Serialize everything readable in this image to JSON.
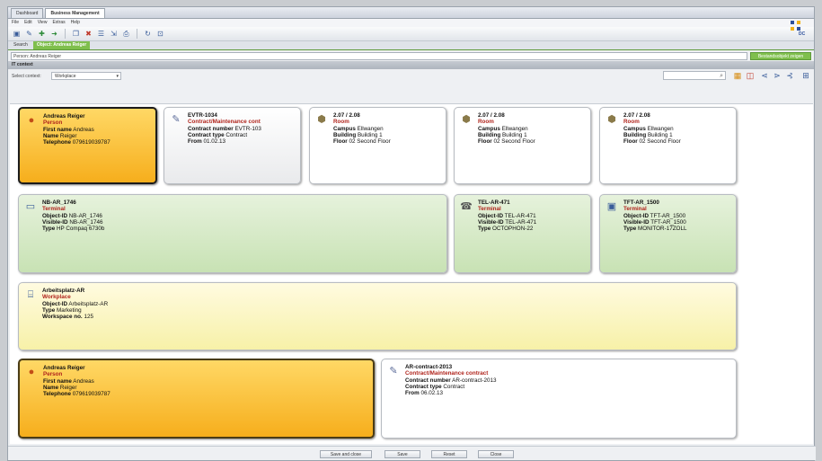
{
  "tabs": [
    "Dashboard",
    "Business Management"
  ],
  "menu": [
    "File",
    "Edit",
    "View",
    "Extras",
    "Help"
  ],
  "logo_text": "DC",
  "subtabs": [
    "Search",
    "Object: Andreas Reiger"
  ],
  "filter": {
    "value": "Person: Andreas Reiger",
    "button": "Bestandsobjekt zeigen"
  },
  "section_title": "IT context",
  "select": {
    "label": "Select context:",
    "value": "Workplace"
  },
  "cards": {
    "person1": {
      "title": "Andreas Reiger",
      "type": "Person",
      "rows": [
        [
          "First name",
          "Andreas"
        ],
        [
          "Name",
          "Reiger"
        ],
        [
          "Telephone",
          "079619039787"
        ]
      ]
    },
    "contract1": {
      "title": "EVTR-1034",
      "type": "Contract/Maintenance cont",
      "rows": [
        [
          "Contract number",
          "EVTR-103"
        ],
        [
          "Contract type",
          "Contract"
        ],
        [
          "From",
          "01.02.13"
        ]
      ]
    },
    "room1": {
      "title": "2.07 / 2.08",
      "type": "Room",
      "rows": [
        [
          "Campus",
          "Ellwangen"
        ],
        [
          "Building",
          "Building 1"
        ],
        [
          "Floor",
          "02 Second Floor"
        ]
      ]
    },
    "room2": {
      "title": "2.07 / 2.08",
      "type": "Room",
      "rows": [
        [
          "Campus",
          "Ellwangen"
        ],
        [
          "Building",
          "Building 1"
        ],
        [
          "Floor",
          "02 Second Floor"
        ]
      ]
    },
    "room3": {
      "title": "2.07 / 2.08",
      "type": "Room",
      "rows": [
        [
          "Campus",
          "Ellwangen"
        ],
        [
          "Building",
          "Building 1"
        ],
        [
          "Floor",
          "02 Second Floor"
        ]
      ]
    },
    "term1": {
      "title": "NB-AR_1746",
      "type": "Terminal",
      "rows": [
        [
          "Object-ID",
          "NB-AR_1746"
        ],
        [
          "Visible-ID",
          "NB-AR_1746"
        ],
        [
          "Type",
          "HP Compaq 6730b"
        ]
      ]
    },
    "term2": {
      "title": "TEL-AR-471",
      "type": "Terminal",
      "rows": [
        [
          "Object-ID",
          "TEL-AR-471"
        ],
        [
          "Visible-ID",
          "TEL-AR-471"
        ],
        [
          "Type",
          "OCTOPHON-22"
        ]
      ]
    },
    "term3": {
      "title": "TFT-AR_1500",
      "type": "Terminal",
      "rows": [
        [
          "Object-ID",
          "TFT-AR_1500"
        ],
        [
          "Visible-ID",
          "TFT-AR_1500"
        ],
        [
          "Type",
          "MONITOR-17ZOLL"
        ]
      ]
    },
    "workplace": {
      "title": "Arbeitsplatz-AR",
      "type": "Workplace",
      "rows": [
        [
          "Object-ID",
          "Arbeitsplatz-AR"
        ],
        [
          "Type",
          "Marketing"
        ],
        [
          "Workspace no.",
          "125"
        ]
      ]
    },
    "person2": {
      "title": "Andreas Reiger",
      "type": "Person",
      "rows": [
        [
          "First name",
          "Andreas"
        ],
        [
          "Name",
          "Reiger"
        ],
        [
          "Telephone",
          "079619039787"
        ]
      ]
    },
    "contract2": {
      "title": "AR-contract-2013",
      "type": "Contract/Maintenance contract",
      "rows": [
        [
          "Contract number",
          "AR-contract-2013"
        ],
        [
          "Contract type",
          "Contract"
        ],
        [
          "From",
          "06.02.13"
        ]
      ]
    }
  },
  "bottom_buttons": [
    "Save and close",
    "Save",
    "Reset",
    "Close"
  ]
}
